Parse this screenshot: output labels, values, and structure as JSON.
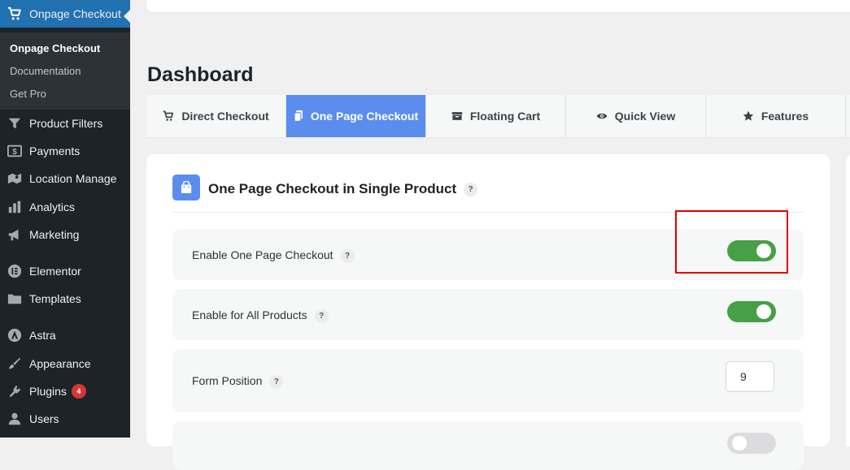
{
  "sidebar": {
    "active_item": {
      "label": "Onpage Checkout",
      "icon": "cart-icon"
    },
    "submenu": [
      "Onpage Checkout",
      "Documentation",
      "Get Pro"
    ],
    "items": [
      {
        "label": "Product Filters",
        "icon": "filter-icon"
      },
      {
        "label": "Payments",
        "icon": "dollar-icon"
      },
      {
        "label": "Location Manage",
        "icon": "location-icon"
      },
      {
        "label": "Analytics",
        "icon": "bar-chart-icon"
      },
      {
        "label": "Marketing",
        "icon": "megaphone-icon"
      },
      {
        "label": "Elementor",
        "icon": "elementor-icon"
      },
      {
        "label": "Templates",
        "icon": "folder-icon"
      },
      {
        "label": "Astra",
        "icon": "astra-icon"
      },
      {
        "label": "Appearance",
        "icon": "brush-icon"
      },
      {
        "label": "Plugins",
        "icon": "plug-icon",
        "badge": "4"
      },
      {
        "label": "Users",
        "icon": "user-icon"
      }
    ]
  },
  "page": {
    "title": "Dashboard"
  },
  "tabs": [
    {
      "label": "Direct Checkout",
      "icon": "cart-icon",
      "active": false
    },
    {
      "label": "One Page Checkout",
      "icon": "pages-icon",
      "active": true
    },
    {
      "label": "Floating Cart",
      "icon": "box-icon",
      "active": false
    },
    {
      "label": "Quick View",
      "icon": "eye-icon",
      "active": false
    },
    {
      "label": "Features",
      "icon": "star-icon",
      "active": false
    }
  ],
  "panel": {
    "title": "One Page Checkout in Single Product",
    "icon": "shopping-bag-icon",
    "help": "?",
    "settings": [
      {
        "label": "Enable One Page Checkout",
        "type": "toggle",
        "enabled": true
      },
      {
        "label": "Enable for All Products",
        "type": "toggle",
        "enabled": true
      },
      {
        "label": "Form Position",
        "type": "number",
        "value": "9"
      }
    ]
  },
  "colors": {
    "sidebar_bg": "#1d2327",
    "sidebar_active": "#2271b1",
    "tab_active": "#5b8def",
    "toggle_on": "#46a046",
    "highlight": "#e00000",
    "badge": "#d63638"
  }
}
